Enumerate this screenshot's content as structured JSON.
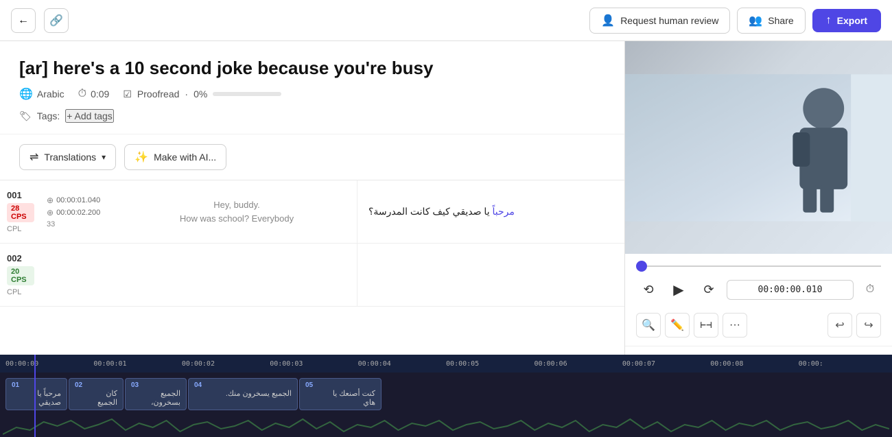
{
  "header": {
    "back_icon": "←",
    "link_icon": "🔗",
    "request_review_label": "Request human review",
    "share_label": "Share",
    "export_label": "Export"
  },
  "project": {
    "title": "[ar] here's a 10 second joke because you're busy",
    "language": "Arabic",
    "duration": "0:09",
    "proofread_label": "Proofread",
    "proofread_percent": "0%",
    "tags_label": "Tags:",
    "add_tags_label": "+ Add tags"
  },
  "toolbar": {
    "translations_label": "Translations",
    "make_with_ai_label": "Make with AI..."
  },
  "subtitles": [
    {
      "index": "001",
      "cps": "28 CPS",
      "cps_high": true,
      "cpl": "CPL",
      "tc_in": "00:00:01.040",
      "tc_out": "00:00:02.200",
      "char_count": "33",
      "source_text": "Hey, buddy.\nHow was school? Everybody",
      "translation": "مرحباً يا صديقي كيف كانت المدرسة؟"
    },
    {
      "index": "002",
      "cps": "20 CPS",
      "cps_high": false,
      "cpl": "CPL",
      "tc_in": "",
      "tc_out": "",
      "char_count": "",
      "source_text": "",
      "translation": ""
    }
  ],
  "player": {
    "timecode": "00:00:00.010",
    "rewind_icon": "⟲",
    "play_icon": "▶",
    "forward_icon": "⟳",
    "clock_icon": "⏱"
  },
  "editor_tools": {
    "search_icon": "🔍",
    "edit_icon": "✏️",
    "fit_icon": "⊢⊣",
    "more_icon": "•••",
    "undo_icon": "↩",
    "redo_icon": "↪"
  },
  "timeline": {
    "ruler_ticks": [
      "00:00:00",
      "00:00:01",
      "00:00:02",
      "00:00:03",
      "00:00:04",
      "00:00:05",
      "00:00:06",
      "00:00:07",
      "00:00:08",
      "00:00:"
    ],
    "segments": [
      {
        "num": "01",
        "text": "مرحباً يا\nصديقي"
      },
      {
        "num": "02",
        "text": "كان\nالجميع"
      },
      {
        "num": "03",
        "text": "الجميع\nبسخرون،"
      },
      {
        "num": "04",
        "text": "الجميع يسخرون منك."
      },
      {
        "num": "05",
        "text": "كنت أصنعك يا\nهاي"
      }
    ]
  }
}
